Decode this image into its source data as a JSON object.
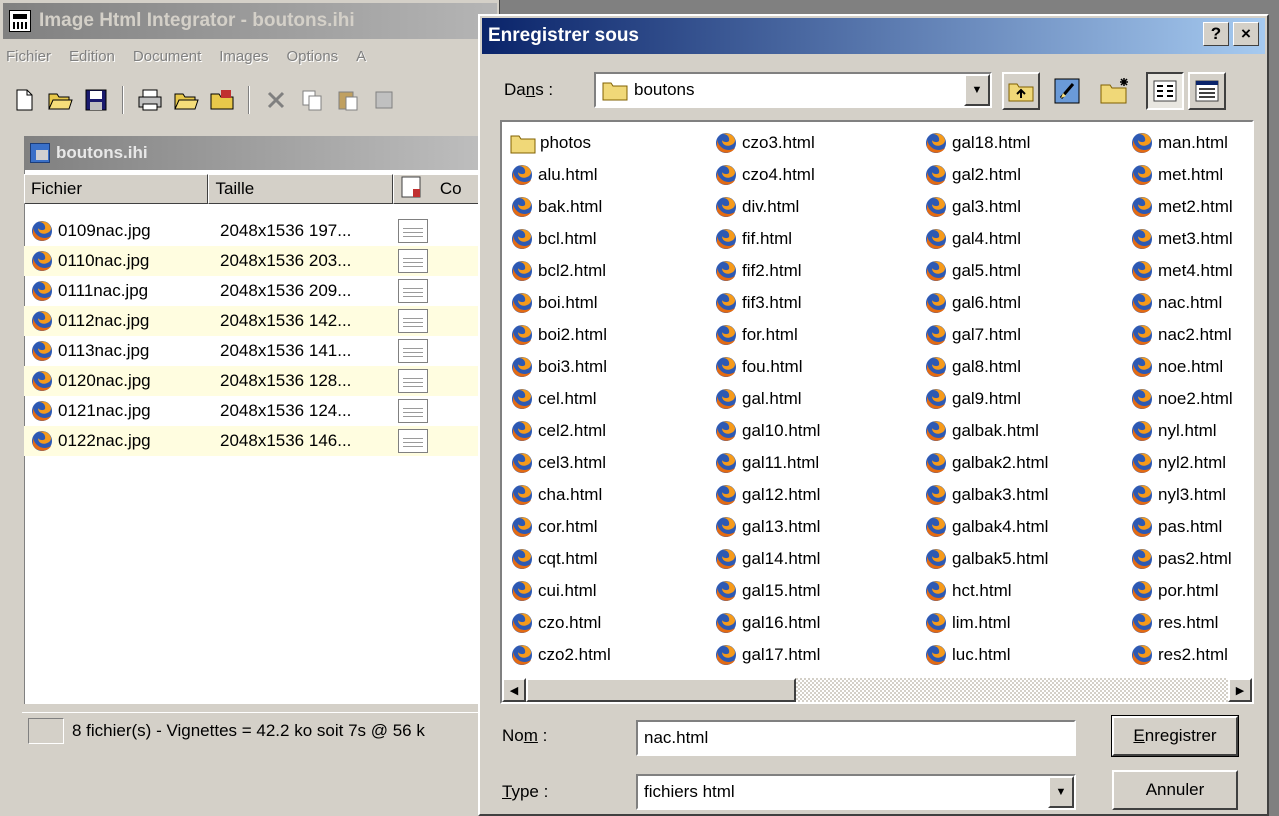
{
  "app": {
    "title": "Image Html Integrator - boutons.ihi",
    "menu": [
      "Fichier",
      "Edition",
      "Document",
      "Images",
      "Options",
      "A"
    ],
    "document": {
      "title": "boutons.ihi",
      "columns": [
        "Fichier",
        "Taille",
        "Co"
      ],
      "rows": [
        {
          "name": "0109nac.jpg",
          "size": "2048x1536  197..."
        },
        {
          "name": "0110nac.jpg",
          "size": "2048x1536  203..."
        },
        {
          "name": "0111nac.jpg",
          "size": "2048x1536  209..."
        },
        {
          "name": "0112nac.jpg",
          "size": "2048x1536  142..."
        },
        {
          "name": "0113nac.jpg",
          "size": "2048x1536  141..."
        },
        {
          "name": "0120nac.jpg",
          "size": "2048x1536  128..."
        },
        {
          "name": "0121nac.jpg",
          "size": "2048x1536  124..."
        },
        {
          "name": "0122nac.jpg",
          "size": "2048x1536  146..."
        }
      ]
    },
    "status": "8 fichier(s) - Vignettes = 42.2 ko soit 7s @ 56 k"
  },
  "dialog": {
    "title": "Enregistrer sous",
    "help_btn": "?",
    "close_btn": "×",
    "dans_label": "Dans :",
    "folder": "boutons",
    "files": [
      [
        "photos",
        "alu.html",
        "bak.html",
        "bcl.html",
        "bcl2.html",
        "boi.html",
        "boi2.html",
        "boi3.html",
        "cel.html",
        "cel2.html",
        "cel3.html",
        "cha.html",
        "cor.html",
        "cqt.html",
        "cui.html",
        "czo.html",
        "czo2.html"
      ],
      [
        "czo3.html",
        "czo4.html",
        "div.html",
        "fif.html",
        "fif2.html",
        "fif3.html",
        "for.html",
        "fou.html",
        "gal.html",
        "gal10.html",
        "gal11.html",
        "gal12.html",
        "gal13.html",
        "gal14.html",
        "gal15.html",
        "gal16.html",
        "gal17.html"
      ],
      [
        "gal18.html",
        "gal2.html",
        "gal3.html",
        "gal4.html",
        "gal5.html",
        "gal6.html",
        "gal7.html",
        "gal8.html",
        "gal9.html",
        "galbak.html",
        "galbak2.html",
        "galbak3.html",
        "galbak4.html",
        "galbak5.html",
        "hct.html",
        "lim.html",
        "luc.html"
      ],
      [
        "man.html",
        "met.html",
        "met2.html",
        "met3.html",
        "met4.html",
        "nac.html",
        "nac2.html",
        "noe.html",
        "noe2.html",
        "nyl.html",
        "nyl2.html",
        "nyl3.html",
        "pas.html",
        "pas2.html",
        "por.html",
        "res.html",
        "res2.html"
      ]
    ],
    "nom_label": "Nom :",
    "nom_value": "nac.html",
    "type_label": "Type :",
    "type_value": "fichiers html",
    "save_btn": "Enregistrer",
    "cancel_btn": "Annuler"
  }
}
